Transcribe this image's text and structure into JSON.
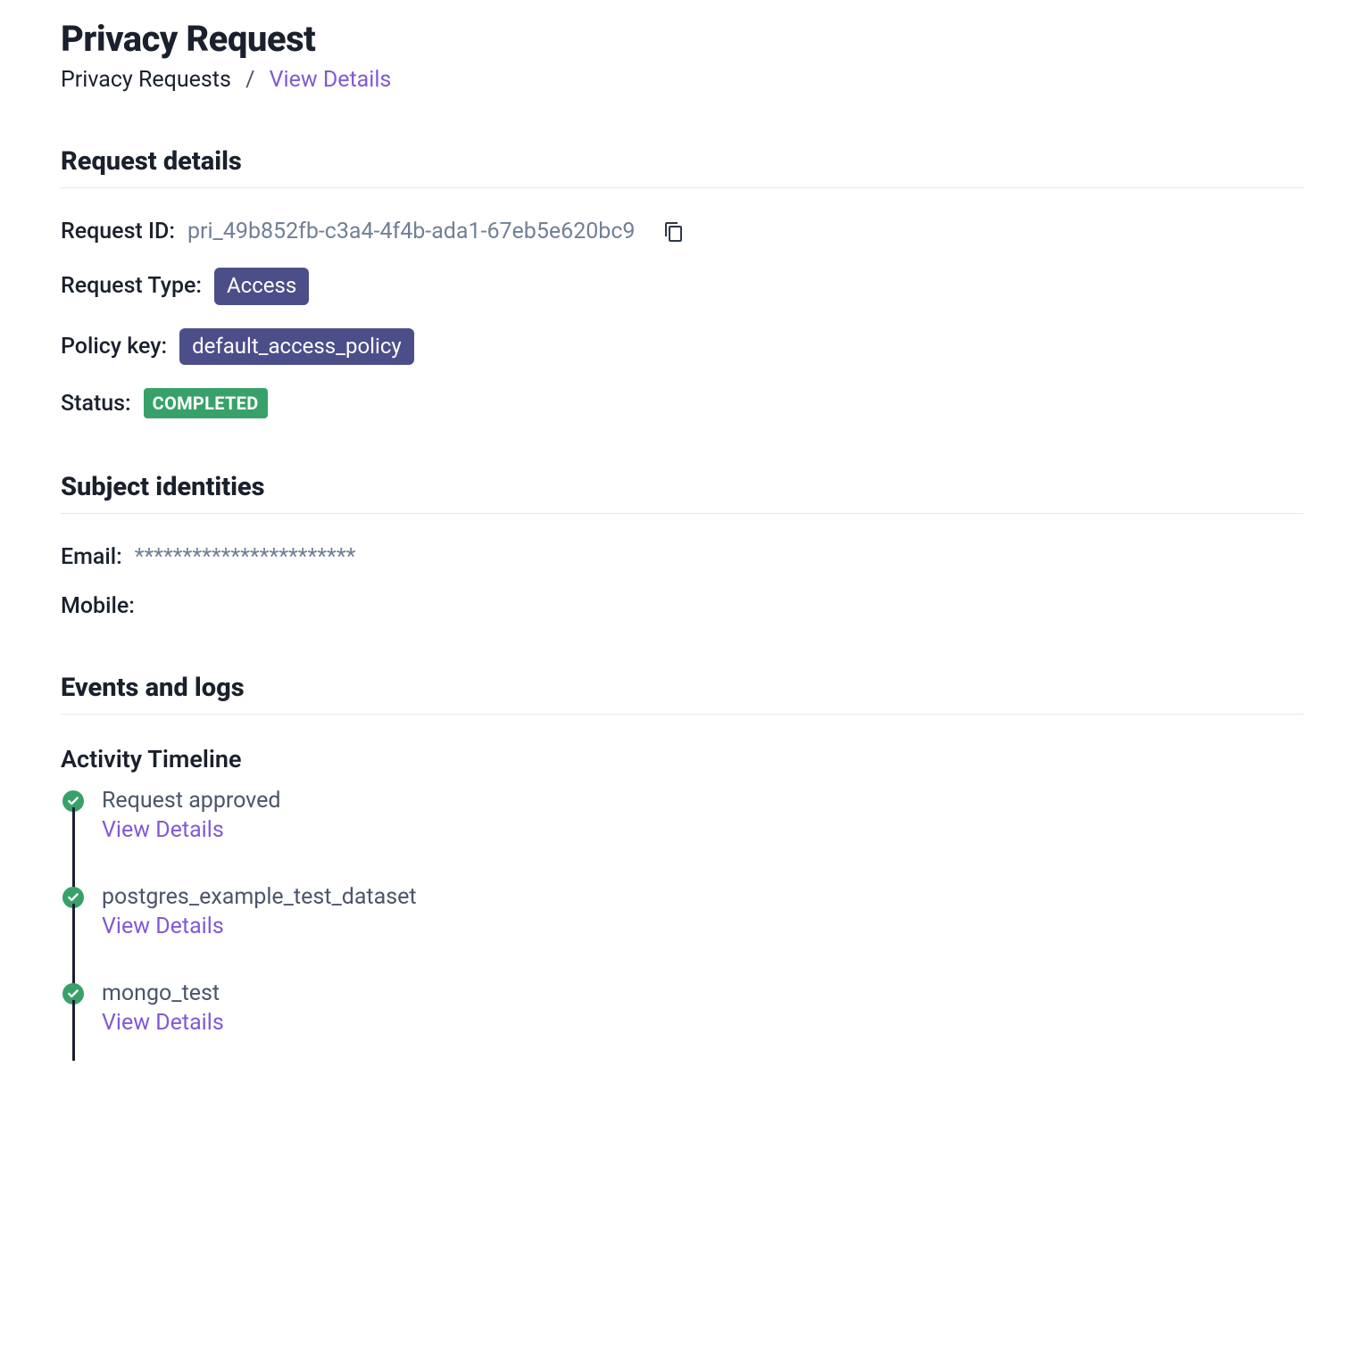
{
  "page": {
    "title": "Privacy Request"
  },
  "breadcrumb": {
    "parent": "Privacy Requests",
    "current": "View Details"
  },
  "sections": {
    "request_details": {
      "title": "Request details",
      "fields": {
        "request_id_label": "Request ID:",
        "request_id_value": "pri_49b852fb-c3a4-4f4b-ada1-67eb5e620bc9",
        "request_type_label": "Request Type:",
        "request_type_value": "Access",
        "policy_key_label": "Policy key:",
        "policy_key_value": "default_access_policy",
        "status_label": "Status:",
        "status_value": "COMPLETED"
      }
    },
    "subject_identities": {
      "title": "Subject identities",
      "fields": {
        "email_label": "Email:",
        "email_value": "***********************",
        "mobile_label": "Mobile:",
        "mobile_value": ""
      }
    },
    "events_and_logs": {
      "title": "Events and logs",
      "activity_title": "Activity Timeline",
      "view_details_label": "View Details",
      "items": [
        {
          "title": "Request approved"
        },
        {
          "title": "postgres_example_test_dataset"
        },
        {
          "title": "mongo_test"
        }
      ]
    }
  }
}
